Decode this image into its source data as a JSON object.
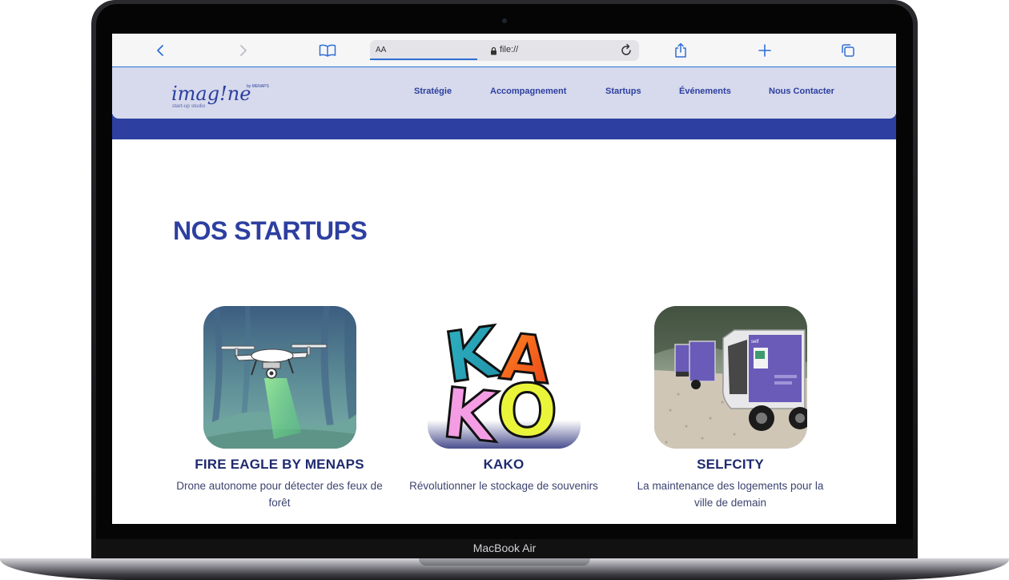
{
  "device": {
    "model_label": "MacBook Air"
  },
  "browser": {
    "address_prefix": "AA",
    "url": "file://",
    "icons": [
      "back-icon",
      "forward-icon",
      "bookmarks-icon",
      "lock-icon",
      "reload-icon",
      "share-icon",
      "new-tab-icon",
      "tabs-icon"
    ]
  },
  "site": {
    "logo": {
      "wordmark": "imag!ne",
      "tagline": "start-up studio",
      "by": "by MENAPS"
    },
    "nav": [
      "Stratégie",
      "Accompagnement",
      "Startups",
      "Événements",
      "Nous Contacter"
    ],
    "section_title": "NOS STARTUPS",
    "startups": [
      {
        "name": "FIRE EAGLE BY MENAPS",
        "description": "Drone autonome pour détecter des feux de forêt",
        "image": "drone-over-forest"
      },
      {
        "name": "KAKO",
        "description": "Révolutionner le stockage de souvenirs",
        "image": "kako-letters-logo",
        "logo_letters": [
          "K",
          "A",
          "K",
          "O"
        ]
      },
      {
        "name": "SELFCITY",
        "description": "La maintenance des logements pour la ville de demain",
        "image": "electric-utility-vehicles"
      }
    ]
  },
  "colors": {
    "brand_blue": "#2d3fa0",
    "header_bg": "#d6daec",
    "title_navy": "#1f2a6e"
  }
}
